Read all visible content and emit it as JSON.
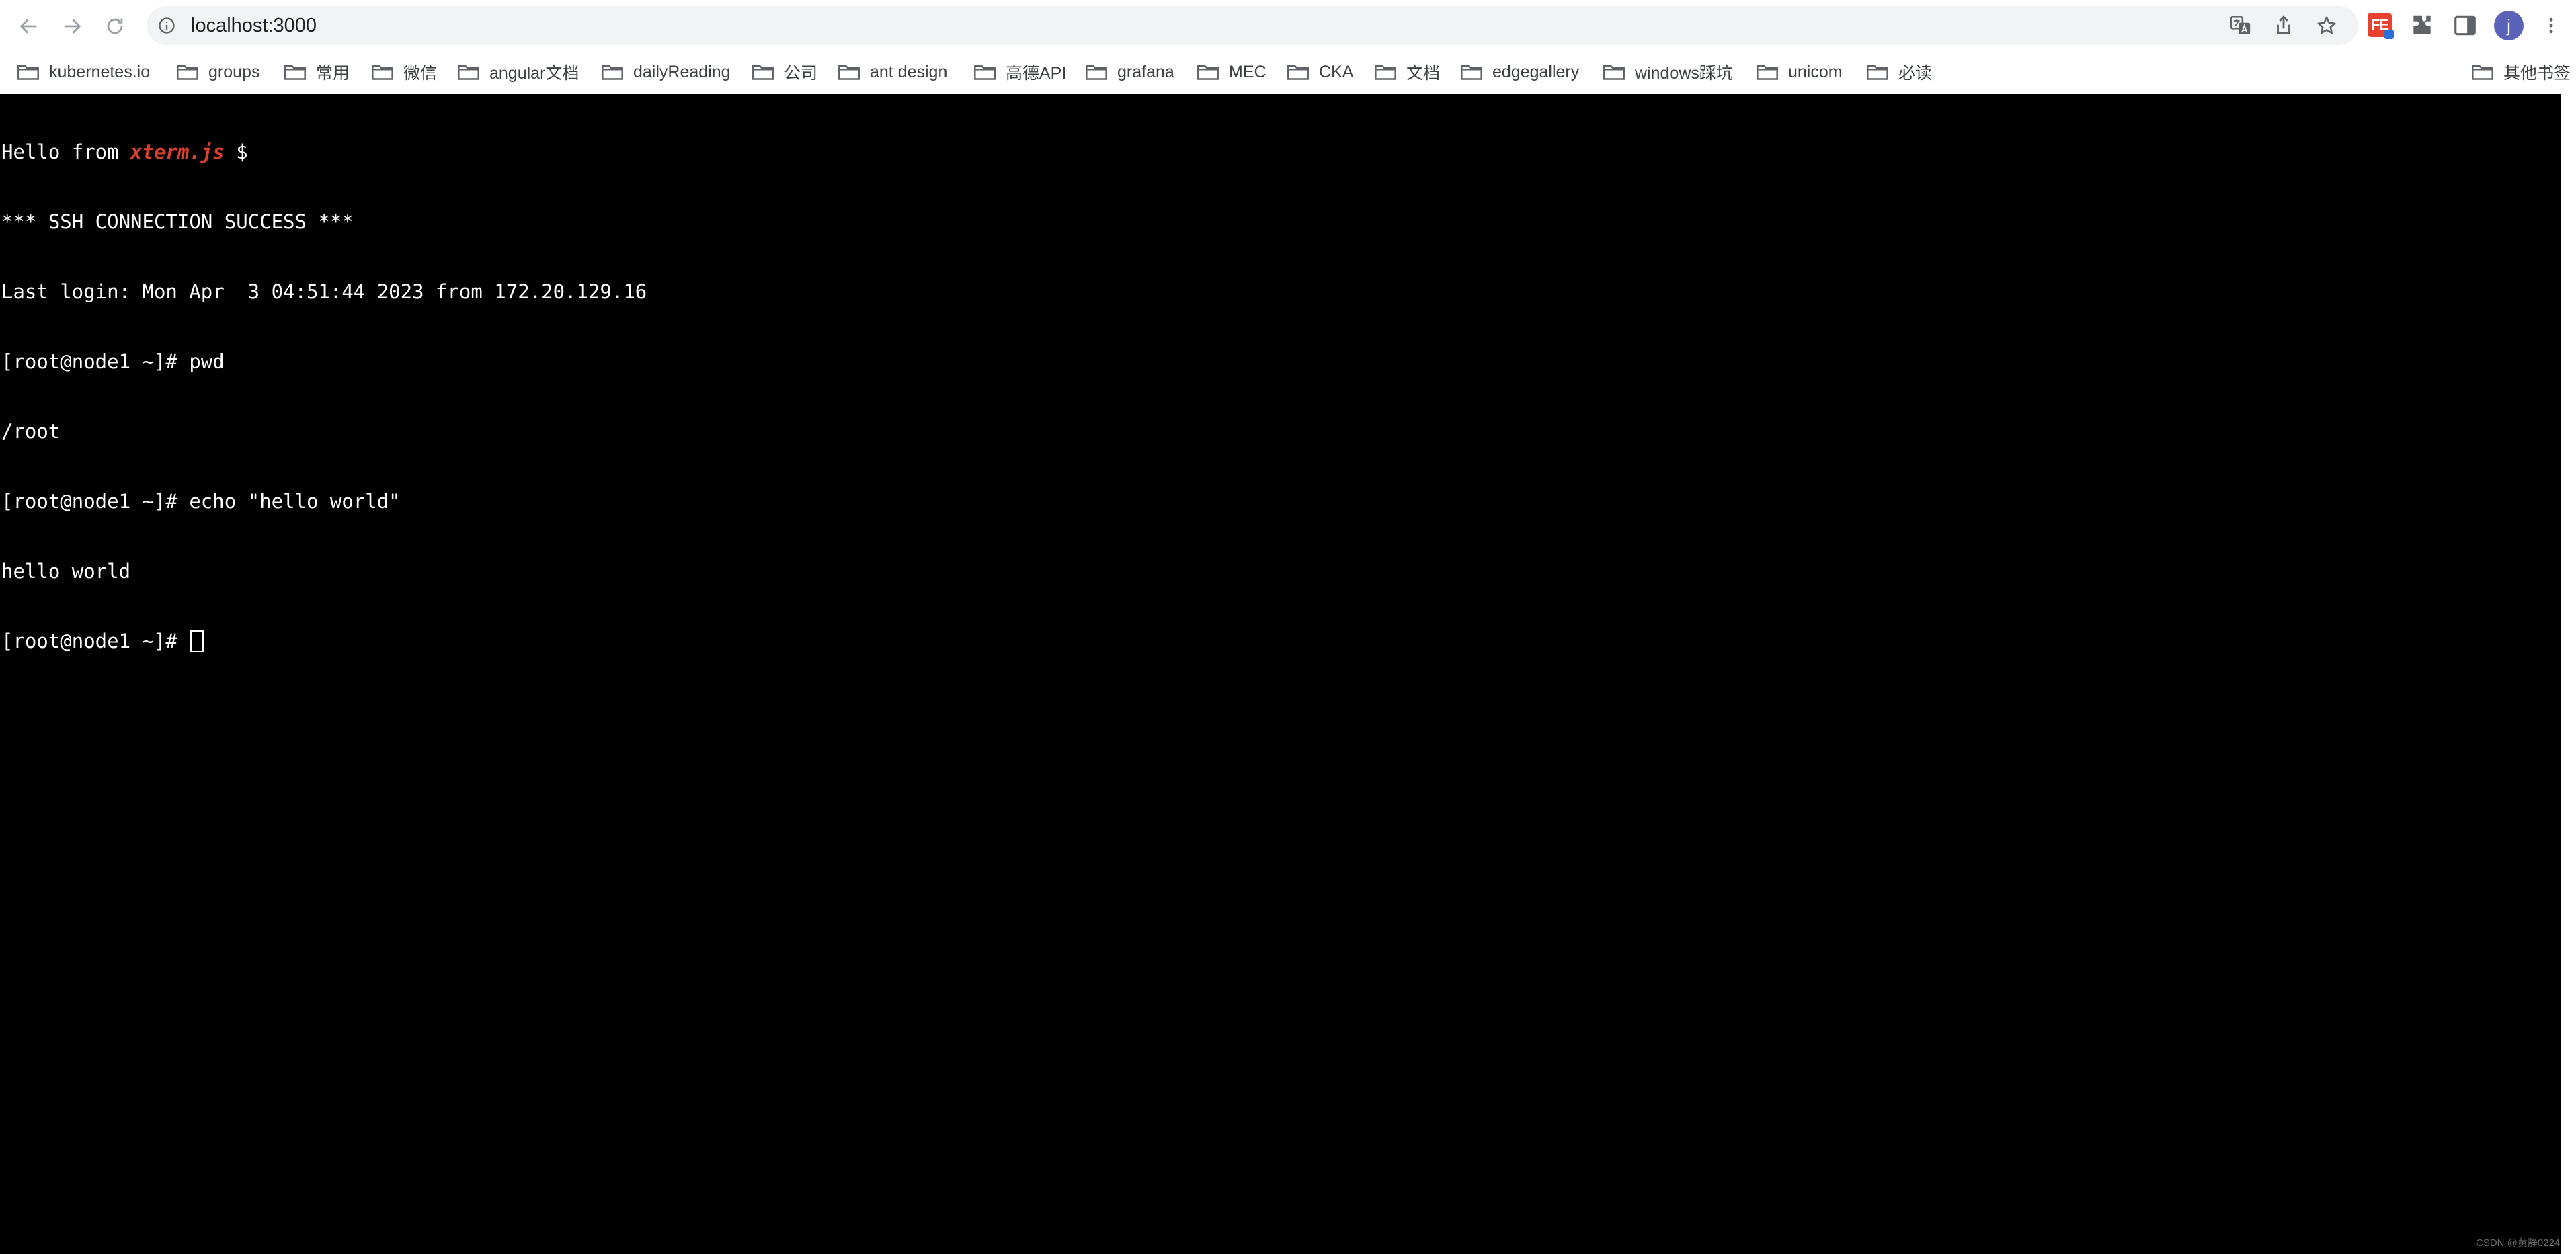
{
  "browser": {
    "url": "localhost:3000",
    "profile_initial": "j",
    "extension_label": "FE"
  },
  "bookmarks": {
    "items": [
      {
        "label": "kubernetes.io"
      },
      {
        "label": "groups"
      },
      {
        "label": "常用"
      },
      {
        "label": "微信"
      },
      {
        "label": "angular文档"
      },
      {
        "label": "dailyReading"
      },
      {
        "label": "公司"
      },
      {
        "label": "ant design"
      },
      {
        "label": "高德API"
      },
      {
        "label": "grafana"
      },
      {
        "label": "MEC"
      },
      {
        "label": "CKA"
      },
      {
        "label": "文档"
      },
      {
        "label": "edgegallery"
      },
      {
        "label": "windows踩坑"
      },
      {
        "label": "unicom"
      },
      {
        "label": "必读"
      }
    ],
    "other_label": "其他书签"
  },
  "terminal": {
    "greeting_prefix": "Hello from ",
    "greeting_highlight": "xterm.js",
    "greeting_suffix": " $",
    "lines": [
      "*** SSH CONNECTION SUCCESS ***",
      "Last login: Mon Apr  3 04:51:44 2023 from 172.20.129.16",
      "[root@node1 ~]# pwd",
      "/root",
      "[root@node1 ~]# echo \"hello world\"",
      "hello world"
    ],
    "prompt": "[root@node1 ~]# "
  },
  "watermark": "CSDN @黄静0224",
  "theme": {
    "terminal_bg": "#000000",
    "terminal_fg": "#ffffff",
    "highlight": "#d7402e"
  }
}
